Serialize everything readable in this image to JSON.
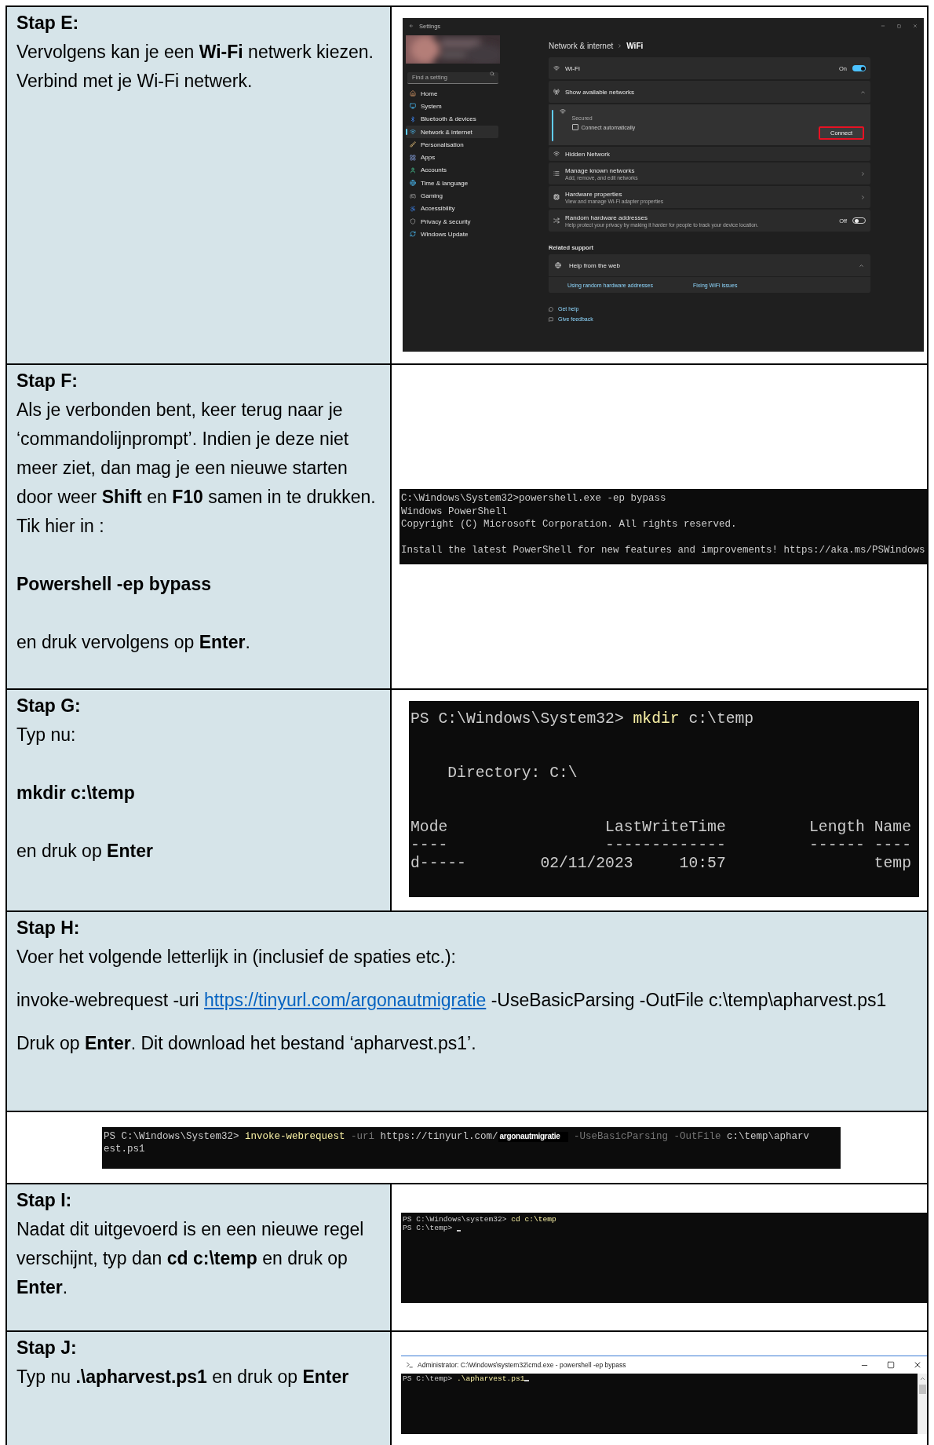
{
  "rows": [
    {
      "kind": "split",
      "title": "Stap E:",
      "paragraphs": [
        {
          "kind": "text",
          "text": "Vervolgens kan je een **Wi-Fi** netwerk kiezen. Verbind met je Wi-Fi netwerk."
        }
      ],
      "screenshot": {
        "kind": "settings",
        "app_title": "Settings",
        "search_placeholder": "Find a setting",
        "nav": [
          {
            "label": "Home",
            "selected": false
          },
          {
            "label": "System",
            "selected": false
          },
          {
            "label": "Bluetooth & devices",
            "selected": false
          },
          {
            "label": "Network & internet",
            "selected": true
          },
          {
            "label": "Personalisation",
            "selected": false
          },
          {
            "label": "Apps",
            "selected": false
          },
          {
            "label": "Accounts",
            "selected": false
          },
          {
            "label": "Time & language",
            "selected": false
          },
          {
            "label": "Gaming",
            "selected": false
          },
          {
            "label": "Accessibility",
            "selected": false
          },
          {
            "label": "Privacy & security",
            "selected": false
          },
          {
            "label": "Windows Update",
            "selected": false
          }
        ],
        "breadcrumb": [
          "Network & internet",
          "WiFi"
        ],
        "rows": [
          {
            "kind": "toggle",
            "title": "Wi-Fi",
            "state_label": "On",
            "on": true
          },
          {
            "kind": "expander",
            "title": "Show available networks",
            "expanded": true
          },
          {
            "kind": "network",
            "status": "Secured",
            "option": "Connect automatically",
            "checked": false,
            "button": "Connect",
            "highlighted": true
          },
          {
            "kind": "plain",
            "title": "Hidden Network"
          },
          {
            "kind": "link",
            "title": "Manage known networks",
            "subtitle": "Add, remove, and edit networks"
          },
          {
            "kind": "link",
            "title": "Hardware properties",
            "subtitle": "View and manage Wi-Fi adapter properties"
          },
          {
            "kind": "toggle",
            "title": "Random hardware addresses",
            "subtitle": "Help protect your privacy by making it harder for people to track your device location.",
            "state_label": "Off",
            "on": false
          }
        ],
        "related_title": "Related support",
        "help": {
          "title": "Help from the web",
          "expanded": true,
          "links": [
            "Using random hardware addresses",
            "Fixing WiFi issues"
          ]
        },
        "footer_links": [
          "Get help",
          "Give feedback"
        ]
      }
    },
    {
      "kind": "split",
      "title": "Stap F:",
      "paragraphs": [
        {
          "kind": "text",
          "text": "Als je verbonden bent, keer terug naar je ‘commandolijnprompt’. Indien je deze niet meer ziet, dan mag je een nieuwe starten door weer **Shift** en **F10** samen in te drukken. Tik hier in :"
        },
        {
          "kind": "command",
          "text": "Powershell -ep bypass"
        },
        {
          "kind": "text",
          "text": "en druk vervolgens op **Enter**."
        }
      ],
      "screenshot": {
        "kind": "console",
        "lines": [
          {
            "kind": "text",
            "cursor": false,
            "parts": [
              {
                "kind": "plain",
                "text": "C:\\Windows\\System32>powershell.exe -ep bypass"
              }
            ]
          },
          {
            "kind": "text",
            "cursor": false,
            "parts": [
              {
                "kind": "plain",
                "text": "Windows PowerShell"
              }
            ]
          },
          {
            "kind": "text",
            "cursor": false,
            "parts": [
              {
                "kind": "plain",
                "text": "Copyright (C) Microsoft Corporation. All rights reserved."
              }
            ]
          },
          {
            "kind": "blank"
          },
          {
            "kind": "text",
            "cursor": false,
            "parts": [
              {
                "kind": "plain",
                "text": "Install the latest PowerShell for new features and improvements! https://aka.ms/PSWindows"
              }
            ]
          }
        ]
      }
    },
    {
      "kind": "split",
      "title": "Stap G:",
      "paragraphs": [
        {
          "kind": "text",
          "text": "Typ nu:"
        },
        {
          "kind": "command",
          "text": "mkdir c:\\temp"
        },
        {
          "kind": "text",
          "text": "en druk op **Enter**"
        }
      ],
      "screenshot": {
        "kind": "zoomed-console",
        "lines": [
          {
            "kind": "text",
            "cursor": false,
            "parts": [
              {
                "kind": "plain",
                "text": "PS C:\\Windows\\System32> "
              },
              {
                "kind": "command",
                "text": "mkdir"
              },
              {
                "kind": "plain",
                "text": " c:\\temp"
              }
            ]
          },
          {
            "kind": "blank"
          },
          {
            "kind": "blank"
          },
          {
            "kind": "text",
            "cursor": false,
            "parts": [
              {
                "kind": "plain",
                "text": "    Directory: C:\\"
              }
            ]
          },
          {
            "kind": "blank"
          },
          {
            "kind": "blank"
          },
          {
            "kind": "text",
            "cursor": false,
            "parts": [
              {
                "kind": "plain",
                "text": "Mode                 LastWriteTime         Length Name"
              }
            ]
          },
          {
            "kind": "text",
            "cursor": false,
            "parts": [
              {
                "kind": "plain",
                "text": "----                 -------------         ------ ----"
              }
            ]
          },
          {
            "kind": "text",
            "cursor": false,
            "parts": [
              {
                "kind": "plain",
                "text": "d-----        02/11/2023     10:57                temp"
              }
            ]
          }
        ]
      }
    },
    {
      "kind": "full_text",
      "title": "Stap H:",
      "paragraphs": [
        {
          "kind": "text",
          "text": "Voer het volgende letterlijk in (inclusief de spaties etc.):"
        },
        {
          "kind": "link",
          "before": "invoke-webrequest -uri ",
          "link": "https://tinyurl.com/argonautmigratie",
          "after": " -UseBasicParsing -OutFile c:\\temp\\apharvest.ps1"
        },
        {
          "kind": "text",
          "text": "Druk op **Enter**. Dit download het bestand ‘apharvest.ps1’."
        }
      ]
    },
    {
      "kind": "full_image",
      "screenshot": {
        "kind": "console",
        "lines": [
          {
            "kind": "text",
            "cursor": false,
            "parts": [
              {
                "kind": "plain",
                "text": "PS C:\\Windows\\System32> "
              },
              {
                "kind": "command",
                "text": "invoke-webrequest"
              },
              {
                "kind": "param",
                "text": " -uri"
              },
              {
                "kind": "plain",
                "text": " https://tinyurl.com/"
              },
              {
                "kind": "redacted",
                "text": "argonautmigratie"
              },
              {
                "kind": "param",
                "text": " -UseBasicParsing -OutFile"
              },
              {
                "kind": "plain",
                "text": " c:\\temp\\apharv"
              }
            ]
          },
          {
            "kind": "text",
            "cursor": false,
            "parts": [
              {
                "kind": "plain",
                "text": "est.ps1"
              }
            ]
          }
        ]
      }
    },
    {
      "kind": "split",
      "title": "Stap I:",
      "paragraphs": [
        {
          "kind": "text",
          "text": "Nadat dit uitgevoerd is en een nieuwe regel verschijnt, typ dan **cd c:\\temp** en druk op **Enter**."
        }
      ],
      "screenshot": {
        "kind": "compact-console",
        "lines": [
          {
            "kind": "text",
            "cursor": false,
            "parts": [
              {
                "kind": "plain",
                "text": "PS C:\\Windows\\system32> "
              },
              {
                "kind": "command",
                "text": "cd c:\\temp"
              }
            ]
          },
          {
            "kind": "text",
            "cursor": true,
            "parts": [
              {
                "kind": "plain",
                "text": "PS C:\\temp> "
              }
            ]
          }
        ]
      }
    },
    {
      "kind": "split",
      "title": "Stap J:",
      "paragraphs": [
        {
          "kind": "text",
          "text": "Typ nu **.\\apharvest.ps1** en druk op **Enter**"
        }
      ],
      "screenshot": {
        "kind": "console-window",
        "title": "Administrator: C:\\Windows\\system32\\cmd.exe - powershell  -ep bypass",
        "lines": [
          {
            "kind": "text",
            "cursor": true,
            "parts": [
              {
                "kind": "plain",
                "text": "PS C:\\temp> "
              },
              {
                "kind": "command",
                "text": ".\\apharvest.ps1"
              }
            ]
          }
        ]
      }
    }
  ]
}
